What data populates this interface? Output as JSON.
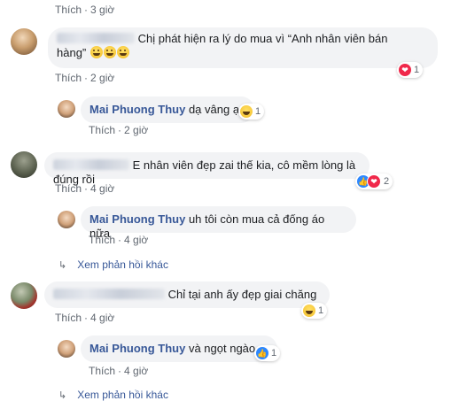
{
  "colors": {
    "name": "#385898",
    "bubble": "#f2f3f5",
    "meta": "#606770",
    "heart": "#f0284a",
    "like": "#2d88ff"
  },
  "comments": [
    {
      "meta": {
        "like": "Thích",
        "time": "3 giờ"
      }
    },
    {
      "author_blurred": true,
      "text": "Chị phát hiện ra lý do mua vì “Anh nhân viên bán hàng”",
      "text_line1": "Chị phát hiện ra lý do mua vì “Anh nhân viên bán",
      "text_line2": "hàng”",
      "emoji": [
        "haha",
        "haha",
        "haha"
      ],
      "reaction": {
        "icons": [
          "heart-icon"
        ],
        "count": "1"
      },
      "meta": {
        "like": "Thích",
        "time": "2 giờ"
      },
      "reply": {
        "author": "Mai Phuong Thuy",
        "text": "dạ vâng ạ",
        "reaction": {
          "icons": [
            "haha-icon"
          ],
          "count": "1"
        },
        "meta": {
          "like": "Thích",
          "time": "2 giờ"
        }
      }
    },
    {
      "author_blurred": true,
      "text": "E nhân viên đẹp zai thế kia, cô mềm lòng là đúng rồi",
      "reaction": {
        "icons": [
          "like-icon",
          "heart-icon"
        ],
        "count": "2"
      },
      "meta": {
        "like": "Thích",
        "time": "4 giờ"
      },
      "reply": {
        "author": "Mai Phuong Thuy",
        "text": "uh tôi còn mua cả đống áo nữa",
        "meta": {
          "like": "Thích",
          "time": "4 giờ"
        }
      },
      "more_replies": "Xem phản hồi khác"
    },
    {
      "author_blurred": true,
      "text": "Chỉ tại anh ấy đẹp giai chăng",
      "reaction": {
        "icons": [
          "haha-icon"
        ],
        "count": "1"
      },
      "meta": {
        "like": "Thích",
        "time": "4 giờ"
      },
      "reply": {
        "author": "Mai Phuong Thuy",
        "text": "và ngọt ngào",
        "reaction": {
          "icons": [
            "like-icon"
          ],
          "count": "1"
        },
        "meta": {
          "like": "Thích",
          "time": "4 giờ"
        }
      },
      "more_replies": "Xem phản hồi khác"
    }
  ]
}
